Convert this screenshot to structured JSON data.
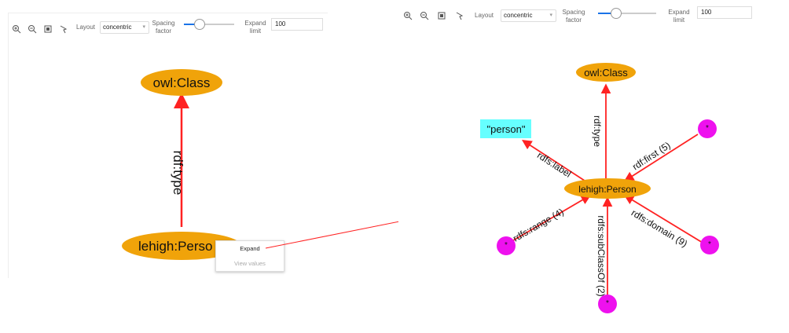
{
  "toolbar": {
    "layout_label": "Layout",
    "layout_value": "concentric",
    "spacing_label_line1": "Spacing",
    "spacing_label_line2": "factor",
    "spacing_value": 0.3,
    "expand_label_line1": "Expand",
    "expand_label_line2": "limit",
    "expand_value": "100",
    "icons": [
      "zoom-in-icon",
      "zoom-out-icon",
      "fit-icon",
      "select-icon"
    ]
  },
  "left_graph": {
    "nodes": {
      "class_node": "owl:Class",
      "person_node": "lehigh:Perso"
    },
    "edge_label": "rdf:type"
  },
  "context_menu": {
    "items": [
      "Expand",
      "View values"
    ]
  },
  "right_graph": {
    "nodes": {
      "class_node": "owl:Class",
      "person_node": "lehigh:Person",
      "literal_node": "\"person\"",
      "blank_1": "*",
      "blank_2": "*",
      "blank_3": "*",
      "blank_4": "*"
    },
    "edges": {
      "type": "rdf:type",
      "label": "rdfs:label",
      "first": "rdf:first (5)",
      "range": "rdfs:range (4)",
      "domain": "rdfs:domain (9)",
      "subclass": "rdfs:subClassOf (2)"
    }
  },
  "colors": {
    "node_orange": "#f0a30a",
    "node_magenta": "#ee11ee",
    "node_cyan": "#66ffff",
    "edge_red": "#ff2222",
    "slider_blue": "#1a73e8"
  }
}
